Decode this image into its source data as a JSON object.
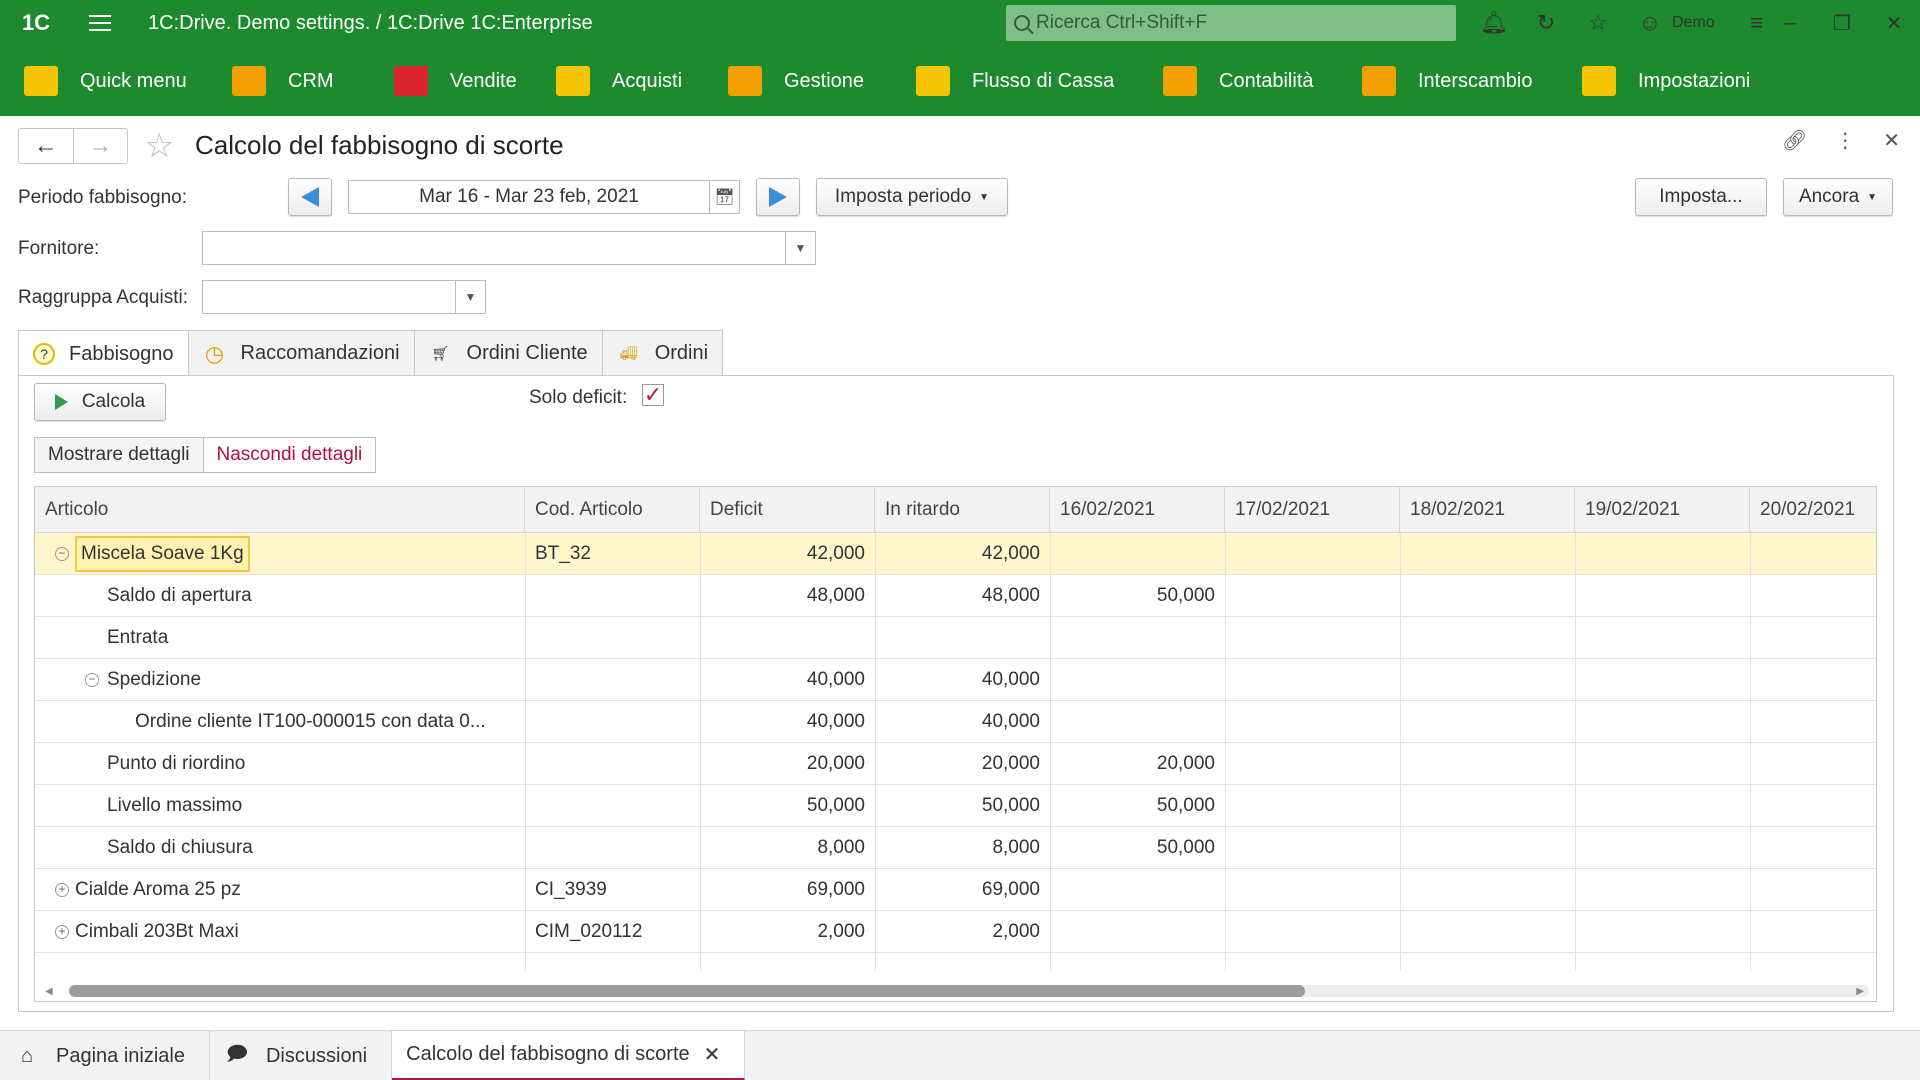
{
  "titlebar": {
    "logo": "1C",
    "title": "1C:Drive. Demo settings. / 1C:Drive 1C:Enterprise",
    "search_placeholder": "Ricerca Ctrl+Shift+F",
    "user": "Demo"
  },
  "sections": [
    {
      "label": "Quick menu",
      "color": "#f5c400",
      "icon": "quick-menu-icon"
    },
    {
      "label": "CRM",
      "color": "#f0a000",
      "icon": "crm-icon"
    },
    {
      "label": "Vendite",
      "color": "#d9262c",
      "icon": "sales-cart-icon"
    },
    {
      "label": "Acquisti",
      "color": "#f5c400",
      "icon": "truck-icon"
    },
    {
      "label": "Gestione",
      "color": "#f0a000",
      "icon": "gear-icon"
    },
    {
      "label": "Flusso di Cassa",
      "color": "#f5c400",
      "icon": "cash-flow-icon"
    },
    {
      "label": "Contabilità",
      "color": "#f0a000",
      "icon": "accounting-icon"
    },
    {
      "label": "Interscambio",
      "color": "#f0a000",
      "icon": "cloud-exchange-icon"
    },
    {
      "label": "Impostazioni",
      "color": "#f5c400",
      "icon": "settings-grid-icon"
    }
  ],
  "form": {
    "title": "Calcolo del fabbisogno di scorte",
    "period_label": "Periodo fabbisogno:",
    "period_value": "Mar 16 - Mar 23 feb, 2021",
    "set_period_button": "Imposta periodo",
    "settings_button": "Imposta...",
    "more_button": "Ancora",
    "supplier_label": "Fornitore:",
    "supplier_value": "",
    "group_label": "Raggruppa Acquisti:",
    "group_value": ""
  },
  "tabs": [
    {
      "label": "Fabbisogno",
      "icon": "question-icon",
      "active": true
    },
    {
      "label": "Raccomandazioni",
      "icon": "clock-icon",
      "active": false
    },
    {
      "label": "Ordini Cliente",
      "icon": "cart-icon",
      "active": false
    },
    {
      "label": "Ordini",
      "icon": "truck-icon",
      "active": false
    }
  ],
  "panel": {
    "calc_button": "Calcola",
    "deficit_only_label": "Solo deficit:",
    "deficit_only_checked": true,
    "show_details": "Mostrare dettagli",
    "hide_details": "Nascondi dettagli"
  },
  "table": {
    "columns": [
      "Articolo",
      "Cod. Articolo",
      "Deficit",
      "In ritardo",
      "16/02/2021",
      "17/02/2021",
      "18/02/2021",
      "19/02/2021",
      "20/02/2021"
    ],
    "rows": [
      {
        "level": 0,
        "toggle": "minus",
        "article": "Miscela Soave 1Kg",
        "code": "BT_32",
        "deficit": "42,000",
        "late": "42,000",
        "d16": "",
        "selected": true
      },
      {
        "level": 1,
        "toggle": "",
        "article": "Saldo di apertura",
        "code": "",
        "deficit": "48,000",
        "late": "48,000",
        "d16": "50,000",
        "selected": false
      },
      {
        "level": 1,
        "toggle": "",
        "article": "Entrata",
        "code": "",
        "deficit": "",
        "late": "",
        "d16": "",
        "selected": false
      },
      {
        "level": 1,
        "toggle": "minus",
        "article": "Spedizione",
        "code": "",
        "deficit": "40,000",
        "late": "40,000",
        "d16": "",
        "selected": false
      },
      {
        "level": 2,
        "toggle": "",
        "article": "Ordine cliente IT100-000015 con data 0...",
        "code": "",
        "deficit": "40,000",
        "late": "40,000",
        "d16": "",
        "selected": false
      },
      {
        "level": 1,
        "toggle": "",
        "article": "Punto di riordino",
        "code": "",
        "deficit": "20,000",
        "late": "20,000",
        "d16": "20,000",
        "selected": false
      },
      {
        "level": 1,
        "toggle": "",
        "article": "Livello massimo",
        "code": "",
        "deficit": "50,000",
        "late": "50,000",
        "d16": "50,000",
        "selected": false
      },
      {
        "level": 1,
        "toggle": "",
        "article": "Saldo di chiusura",
        "code": "",
        "deficit": "8,000",
        "late": "8,000",
        "d16": "50,000",
        "selected": false
      },
      {
        "level": 0,
        "toggle": "plus",
        "article": "Cialde Aroma 25 pz",
        "code": "CI_3939",
        "deficit": "69,000",
        "late": "69,000",
        "d16": "",
        "selected": false
      },
      {
        "level": 0,
        "toggle": "plus",
        "article": "Cimbali 203Bt Maxi",
        "code": "CIM_020112",
        "deficit": "2,000",
        "late": "2,000",
        "d16": "",
        "selected": false
      }
    ]
  },
  "bottom_tabs": [
    {
      "label": "Pagina iniziale",
      "icon": "home-icon",
      "active": false,
      "closable": false
    },
    {
      "label": "Discussioni",
      "icon": "chat-icon",
      "active": false,
      "closable": false
    },
    {
      "label": "Calcolo del fabbisogno di scorte",
      "icon": "",
      "active": true,
      "closable": true
    }
  ]
}
